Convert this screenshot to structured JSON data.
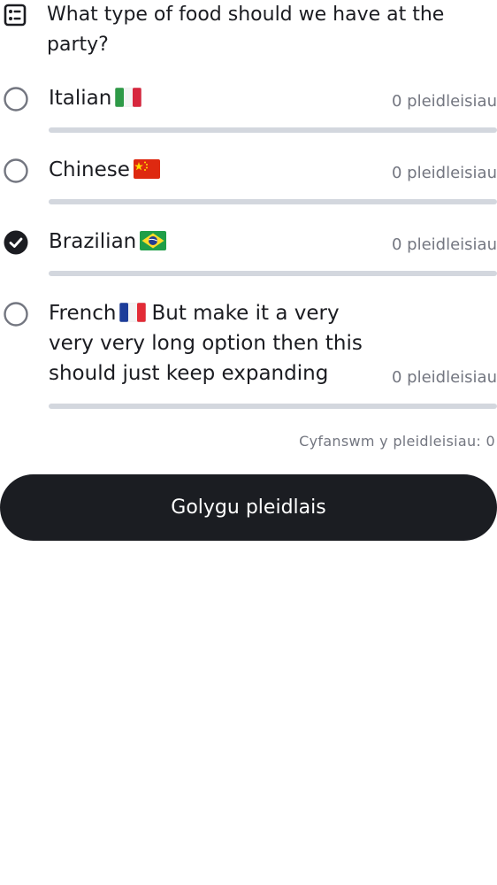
{
  "poll": {
    "question": "What type of food should we have at the party?",
    "options": [
      {
        "label": "Italian",
        "flag": "italy-flag-icon",
        "votes_text": "0 pleidleisiau",
        "votes": 0,
        "selected": false
      },
      {
        "label": "Chinese",
        "flag": "china-flag-icon",
        "votes_text": "0 pleidleisiau",
        "votes": 0,
        "selected": false
      },
      {
        "label": "Brazilian",
        "flag": "brazil-flag-icon",
        "votes_text": "0 pleidleisiau",
        "votes": 0,
        "selected": true
      },
      {
        "label_before": "French",
        "label_after": "But make it a very very very long option then this should just keep expanding",
        "flag": "france-flag-icon",
        "votes_text": "0 pleidleisiau",
        "votes": 0,
        "selected": false
      }
    ],
    "total_text": "Cyfanswm y pleidleisiau: 0",
    "edit_button_label": "Golygu pleidlais"
  },
  "colors": {
    "text": "#1b1c21",
    "muted": "#737680",
    "track": "#d3d7de",
    "button_bg": "#1b1d22",
    "radio_border": "#737680",
    "radio_selected": "#1b1c21"
  }
}
